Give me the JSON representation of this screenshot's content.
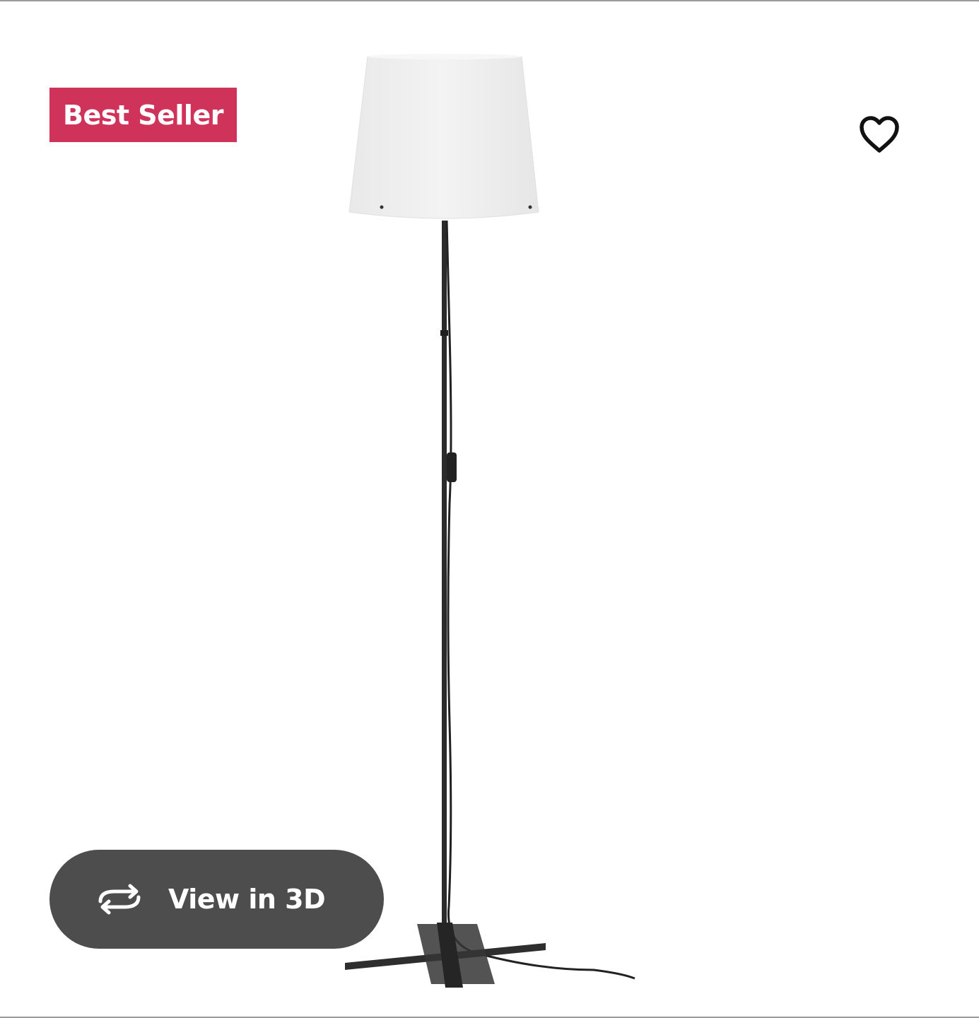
{
  "badge": {
    "label": "Best Seller",
    "color": "#d0335a"
  },
  "favorite": {
    "icon": "heart-outline-icon"
  },
  "product": {
    "image_description_icon": "floor-lamp-image"
  },
  "view_3d": {
    "label": "View in 3D",
    "icon": "rotate-3d-icon",
    "background": "#4d4d4d"
  }
}
